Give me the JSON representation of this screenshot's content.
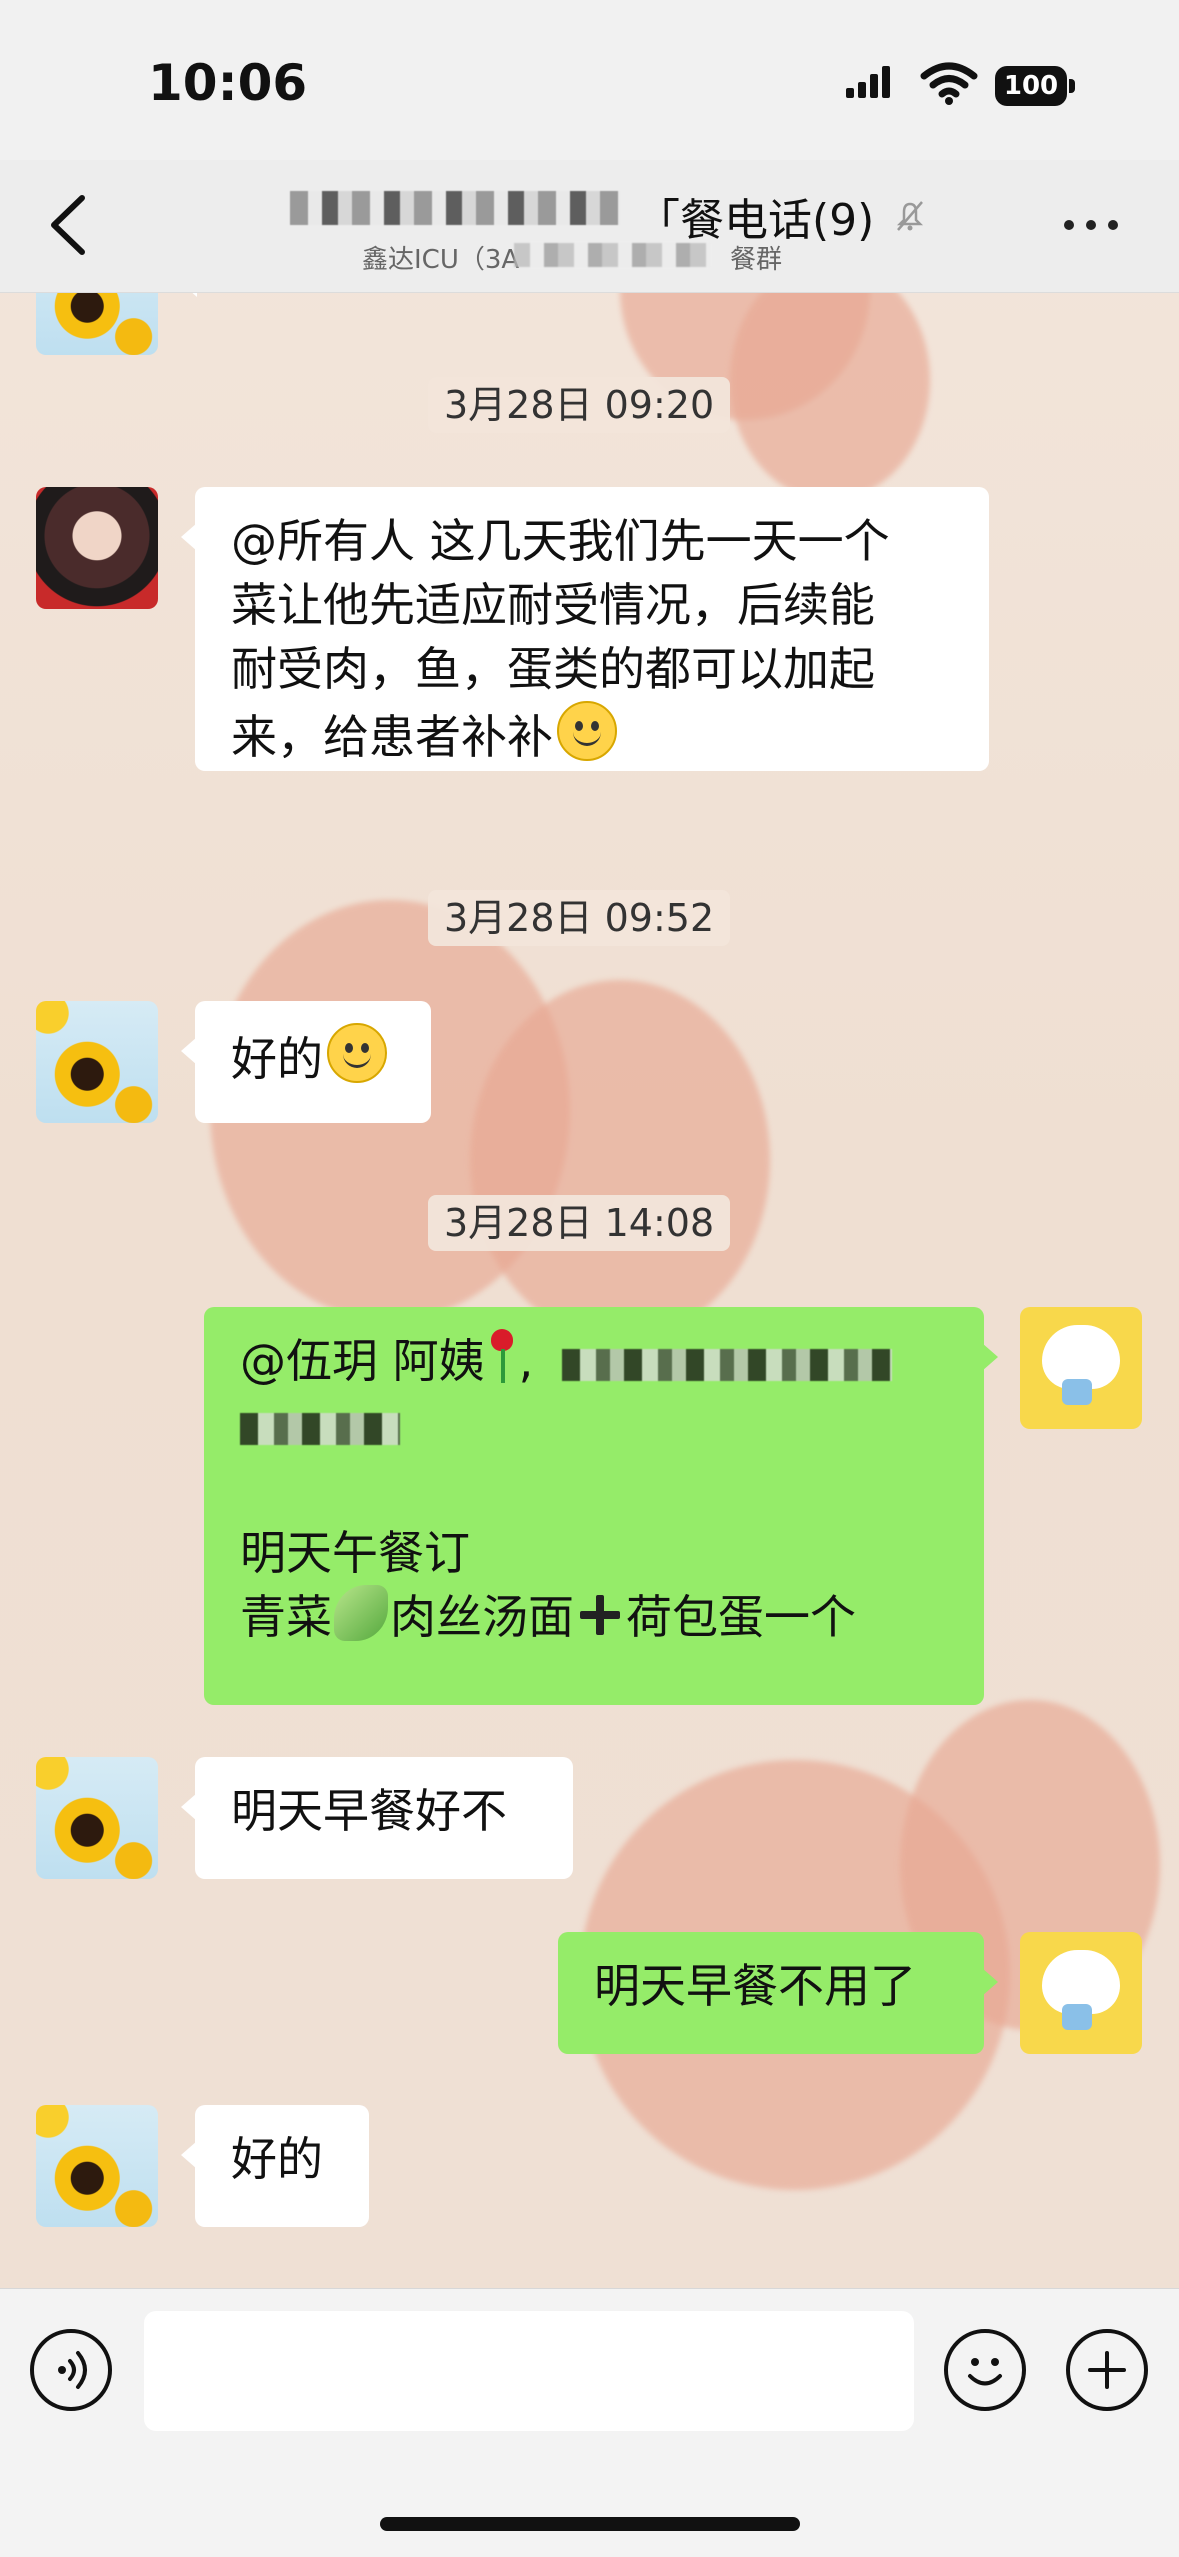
{
  "status_bar": {
    "time": "10:06",
    "battery": "100"
  },
  "header": {
    "title_suffix": "「餐电话(9)",
    "subtitle_left": "鑫达ICU（3A",
    "subtitle_right": "餐群"
  },
  "messages": [
    {
      "type": "timestamp",
      "text": "3月28日 09:20"
    },
    {
      "type": "message",
      "side": "left",
      "avatar": "avatar-girl-icon",
      "lines": [
        "@所有人 这几天我们先一天一个",
        "菜让他先适应耐受情况，后续能",
        "耐受肉，鱼，蛋类的都可以加起",
        "来，给患者补补"
      ],
      "emoji": "smiling-face-emoji"
    },
    {
      "type": "timestamp",
      "text": "3月28日 09:52"
    },
    {
      "type": "message",
      "side": "left",
      "avatar": "sunflower-avatar-icon",
      "lines": [
        "好的"
      ],
      "emoji": "smiling-face-emoji"
    },
    {
      "type": "timestamp",
      "text": "3月28日 14:08"
    },
    {
      "type": "message",
      "side": "right",
      "avatar": "white-dog-avatar-icon",
      "line1_text": "@伍玥 阿姨",
      "line1_separator": ",",
      "line3_text": "明天午餐订",
      "line4_prefix": "青菜",
      "line4_middle": "肉丝汤面",
      "line4_suffix": "荷包蛋一个"
    },
    {
      "type": "message",
      "side": "left",
      "avatar": "sunflower-avatar-icon",
      "lines": [
        "明天早餐好不"
      ]
    },
    {
      "type": "message",
      "side": "right",
      "avatar": "white-dog-avatar-icon",
      "lines": [
        "明天早餐不用了"
      ]
    },
    {
      "type": "message",
      "side": "left",
      "avatar": "sunflower-avatar-icon",
      "lines": [
        "好的"
      ]
    }
  ],
  "bottom_bar": {
    "input_placeholder": ""
  },
  "colors": {
    "left_bubble": "#ffffff",
    "right_bubble": "#95ec69",
    "timestamp_bg": "#f2e5da",
    "background": "#efe2d7"
  }
}
